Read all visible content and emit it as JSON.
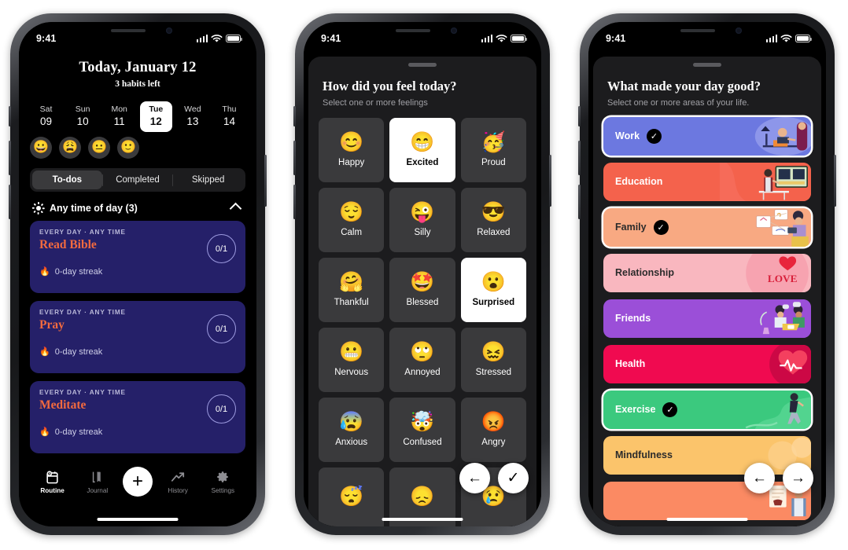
{
  "status_bar": {
    "time": "9:41",
    "signal_icon": "cellular-bars-icon",
    "wifi_icon": "wifi-icon",
    "battery_icon": "battery-icon"
  },
  "phone1": {
    "header": {
      "title": "Today, January 12",
      "subtitle": "3 habits left"
    },
    "week": [
      {
        "name": "Sat",
        "num": "09",
        "selected": false,
        "mood": "😀"
      },
      {
        "name": "Sun",
        "num": "10",
        "selected": false,
        "mood": "😩"
      },
      {
        "name": "Mon",
        "num": "11",
        "selected": false,
        "mood": "😐"
      },
      {
        "name": "Tue",
        "num": "12",
        "selected": true,
        "mood": "🙂"
      },
      {
        "name": "Wed",
        "num": "13",
        "selected": false,
        "mood": ""
      },
      {
        "name": "Thu",
        "num": "14",
        "selected": false,
        "mood": ""
      }
    ],
    "segments": [
      {
        "label": "To-dos",
        "selected": true
      },
      {
        "label": "Completed",
        "selected": false
      },
      {
        "label": "Skipped",
        "selected": false
      }
    ],
    "section": {
      "icon": "sun-icon",
      "label": "Any time of day (3)",
      "collapse_icon": "chevron-up-icon"
    },
    "habits": [
      {
        "meta": "EVERY DAY · ANY TIME",
        "name": "Read Bible",
        "streak": "0-day streak",
        "progress": "0/1",
        "streak_icon": "flame-icon"
      },
      {
        "meta": "EVERY DAY · ANY TIME",
        "name": "Pray",
        "streak": "0-day streak",
        "progress": "0/1",
        "streak_icon": "flame-icon"
      },
      {
        "meta": "EVERY DAY · ANY TIME",
        "name": "Meditate",
        "streak": "0-day streak",
        "progress": "0/1",
        "streak_icon": "flame-icon"
      }
    ],
    "tabs": [
      {
        "label": "Routine",
        "icon": "calendar-clock-icon",
        "active": true
      },
      {
        "label": "Journal",
        "icon": "book-icon",
        "active": false
      },
      {
        "label": "",
        "icon": "plus-icon",
        "active": false
      },
      {
        "label": "History",
        "icon": "trending-up-icon",
        "active": false
      },
      {
        "label": "Settings",
        "icon": "gear-icon",
        "active": false
      }
    ],
    "card_color": "#252069",
    "accent_color": "#f26a3f"
  },
  "phone2": {
    "sheet": {
      "title": "How did you feel today?",
      "subtitle": "Select one or more feelings",
      "grabber": "drag-handle"
    },
    "feelings": [
      {
        "label": "Happy",
        "emoji": "😊",
        "selected": false
      },
      {
        "label": "Excited",
        "emoji": "😁",
        "selected": true
      },
      {
        "label": "Proud",
        "emoji": "🥳",
        "selected": false
      },
      {
        "label": "Calm",
        "emoji": "😌",
        "selected": false
      },
      {
        "label": "Silly",
        "emoji": "😜",
        "selected": false
      },
      {
        "label": "Relaxed",
        "emoji": "😎",
        "selected": false
      },
      {
        "label": "Thankful",
        "emoji": "🤗",
        "selected": false
      },
      {
        "label": "Blessed",
        "emoji": "🤩",
        "selected": false
      },
      {
        "label": "Surprised",
        "emoji": "😮",
        "selected": true
      },
      {
        "label": "Nervous",
        "emoji": "😬",
        "selected": false
      },
      {
        "label": "Annoyed",
        "emoji": "🙄",
        "selected": false
      },
      {
        "label": "Stressed",
        "emoji": "😖",
        "selected": false
      },
      {
        "label": "Anxious",
        "emoji": "😰",
        "selected": false
      },
      {
        "label": "Confused",
        "emoji": "🤯",
        "selected": false
      },
      {
        "label": "Angry",
        "emoji": "😡",
        "selected": false
      },
      {
        "label": "",
        "emoji": "😴",
        "selected": false
      },
      {
        "label": "",
        "emoji": "😞",
        "selected": false
      },
      {
        "label": "",
        "emoji": "😢",
        "selected": false
      }
    ],
    "actions": [
      {
        "name": "back",
        "icon": "arrow-left-icon",
        "glyph": "←"
      },
      {
        "name": "confirm",
        "icon": "checkmark-icon",
        "glyph": "✓"
      }
    ]
  },
  "phone3": {
    "sheet": {
      "title": "What made your day good?",
      "subtitle": "Select one or more areas of your life.",
      "grabber": "drag-handle"
    },
    "areas": [
      {
        "label": "Work",
        "selected": true,
        "bg": "#6c78e0",
        "text": "#ffffff",
        "art": "work"
      },
      {
        "label": "Education",
        "selected": false,
        "bg": "#f4624c",
        "text": "#ffffff",
        "art": "education"
      },
      {
        "label": "Family",
        "selected": true,
        "bg": "#f8a982",
        "text": "#2b2b2b",
        "art": "family"
      },
      {
        "label": "Relationship",
        "selected": false,
        "bg": "#f9b7bf",
        "text": "#2b2b2b",
        "art": "love"
      },
      {
        "label": "Friends",
        "selected": false,
        "bg": "#9b4fd8",
        "text": "#ffffff",
        "art": "friends"
      },
      {
        "label": "Health",
        "selected": false,
        "bg": "#f00a50",
        "text": "#ffffff",
        "art": "health"
      },
      {
        "label": "Exercise",
        "selected": true,
        "bg": "#3bc97e",
        "text": "#ffffff",
        "art": "exercise"
      },
      {
        "label": "Mindfulness",
        "selected": false,
        "bg": "#fbc униcode",
        "text": "#2b2b2b",
        "art": "mindfulness"
      },
      {
        "label": "",
        "selected": false,
        "bg": "#fb8a63",
        "text": "#2b2b2b",
        "art": "cooking"
      }
    ],
    "actions": [
      {
        "name": "back",
        "icon": "arrow-left-icon",
        "glyph": "←"
      },
      {
        "name": "next",
        "icon": "arrow-right-icon",
        "glyph": "→"
      }
    ],
    "check_icon": "checkmark-badge-icon"
  }
}
